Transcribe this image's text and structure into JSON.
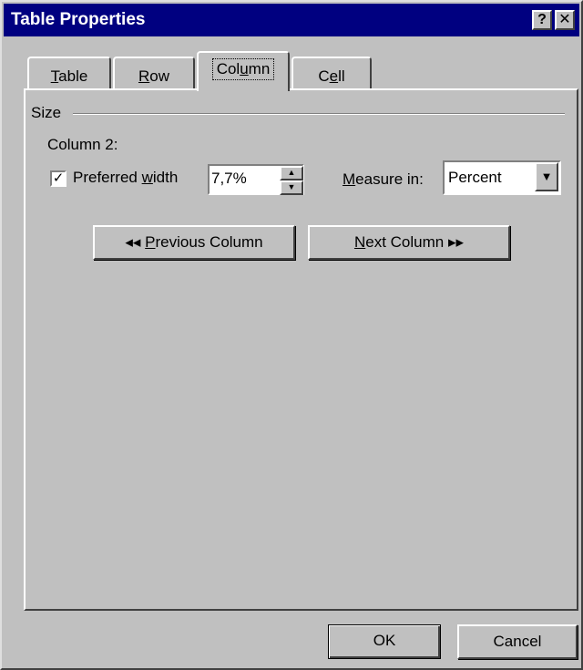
{
  "window": {
    "title": "Table Properties",
    "help_glyph": "?",
    "close_glyph": "✕"
  },
  "tabs": [
    {
      "label": "Table",
      "mnemonic": "T",
      "rest": "able",
      "active": false
    },
    {
      "label": "Row",
      "mnemonic": "R",
      "rest": "ow",
      "active": false
    },
    {
      "label": "Column",
      "pre": "Col",
      "mnemonic": "u",
      "rest": "mn",
      "active": true
    },
    {
      "label": "Cell",
      "pre": "C",
      "mnemonic": "e",
      "rest": "ll",
      "active": false
    }
  ],
  "size_group": {
    "label": "Size",
    "column_label": "Column 2:",
    "preferred_width": {
      "checked": true,
      "check_glyph": "✓",
      "label_pre": "Preferred ",
      "label_mnemonic": "w",
      "label_rest": "idth",
      "value": "7,7%"
    },
    "measure_in": {
      "label_mnemonic": "M",
      "label_rest": "easure in:",
      "value": "Percent"
    },
    "previous_button": {
      "arrows": "◂◂",
      "mnemonic": "P",
      "rest": "revious Column"
    },
    "next_button": {
      "mnemonic": "N",
      "rest": "ext Column",
      "arrows": "▸▸"
    }
  },
  "buttons": {
    "ok": "OK",
    "cancel": "Cancel"
  },
  "icons": {
    "spin_up": "▲",
    "spin_down": "▼",
    "dropdown": "▼"
  },
  "colors": {
    "title_bar": "#000080",
    "face": "#c0c0c0"
  }
}
